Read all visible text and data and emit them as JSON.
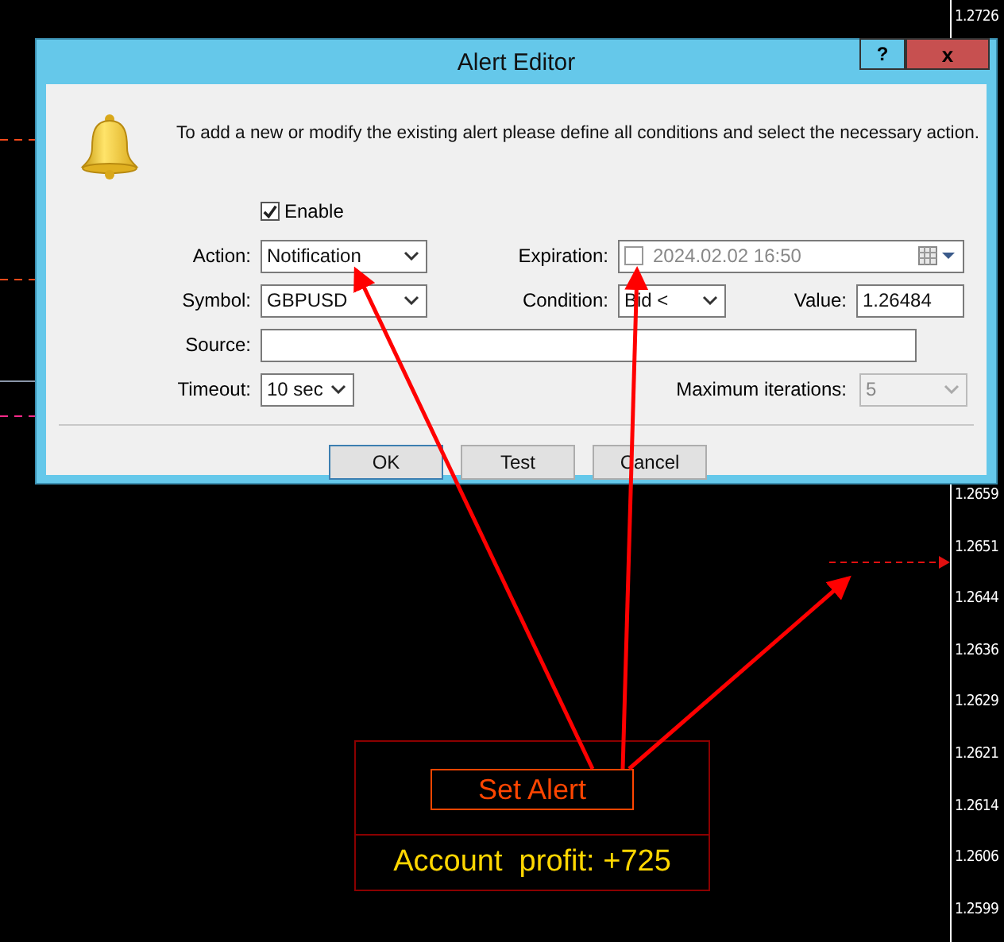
{
  "window": {
    "title": "Alert Editor",
    "help_button": "?",
    "close_button": "x"
  },
  "message": "To add a new or modify the existing alert please define all conditions and select the necessary action.",
  "enable": {
    "label": "Enable",
    "checked": true
  },
  "action": {
    "label": "Action:",
    "value": "Notification"
  },
  "expiration": {
    "label": "Expiration:",
    "checked": false,
    "value": "2024.02.02 16:50"
  },
  "symbol": {
    "label": "Symbol:",
    "value": "GBPUSD"
  },
  "condition": {
    "label": "Condition:",
    "value": "Bid <"
  },
  "value": {
    "label": "Value:",
    "value": "1.26484"
  },
  "source": {
    "label": "Source:"
  },
  "timeout": {
    "label": "Timeout:",
    "value": "10 sec"
  },
  "max_iterations": {
    "label": "Maximum iterations:",
    "value": "5",
    "disabled": true
  },
  "buttons": [
    {
      "label": "OK",
      "default": true
    },
    {
      "label": "Test",
      "default": false
    },
    {
      "label": "Cancel",
      "default": false
    }
  ],
  "chart": {
    "price_labels": [
      "1.2726",
      "1.2659",
      "1.2651",
      "1.2644",
      "1.2636",
      "1.2629",
      "1.2621",
      "1.2614",
      "1.2606",
      "1.2599"
    ],
    "set_alert_button": "Set Alert",
    "account_profit": "Account  profit: +725"
  }
}
